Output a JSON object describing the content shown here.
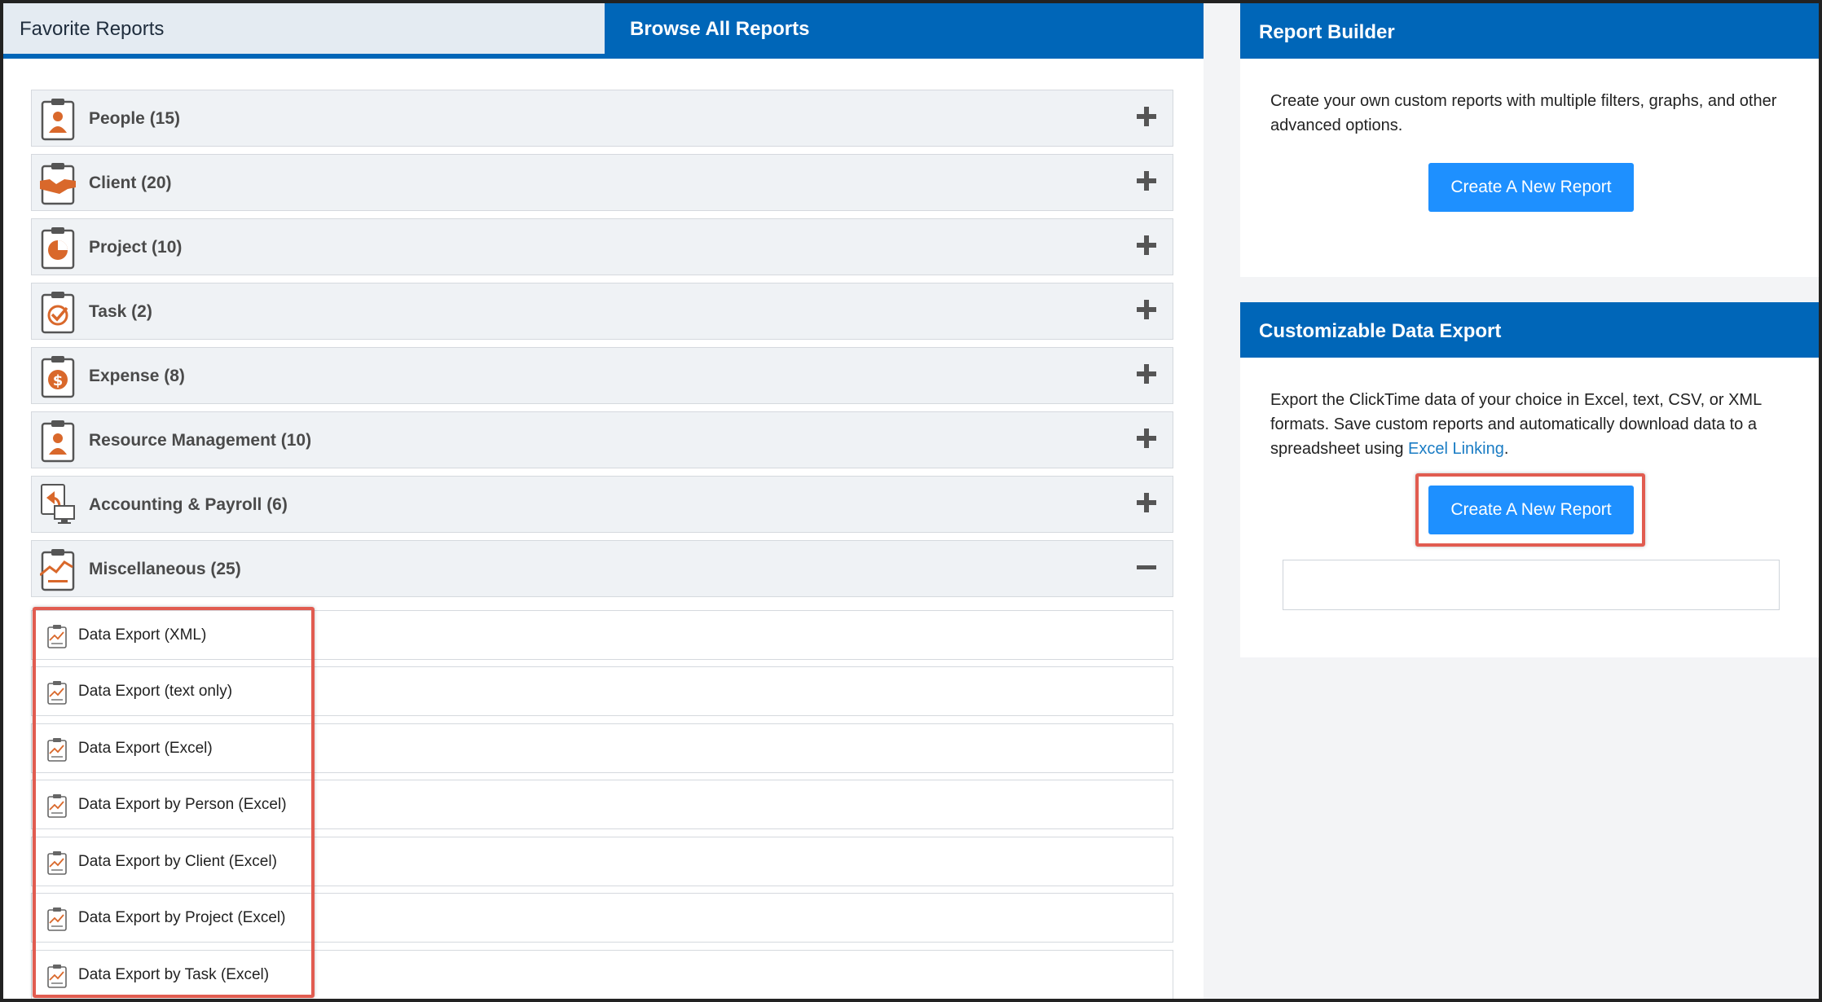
{
  "tabs": {
    "favorites": "Favorite Reports",
    "browse": "Browse All Reports"
  },
  "categories": [
    {
      "label": "People (15)",
      "icon": "person-clipboard-icon",
      "toggle": "plus"
    },
    {
      "label": "Client (20)",
      "icon": "handshake-clipboard-icon",
      "toggle": "plus"
    },
    {
      "label": "Project (10)",
      "icon": "pie-chart-clipboard-icon",
      "toggle": "plus"
    },
    {
      "label": "Task (2)",
      "icon": "checkmark-clipboard-icon",
      "toggle": "plus"
    },
    {
      "label": "Expense (8)",
      "icon": "dollar-clipboard-icon",
      "toggle": "plus"
    },
    {
      "label": "Resource Management (10)",
      "icon": "person-clipboard-icon",
      "toggle": "plus"
    },
    {
      "label": "Accounting & Payroll (6)",
      "icon": "monitor-return-icon",
      "toggle": "plus"
    },
    {
      "label": "Miscellaneous (25)",
      "icon": "line-chart-clipboard-icon",
      "toggle": "minus"
    }
  ],
  "reports": [
    "Data Export (XML)",
    "Data Export (text only)",
    "Data Export (Excel)",
    "Data Export by Person (Excel)",
    "Data Export by Client (Excel)",
    "Data Export by Project (Excel)",
    "Data Export by Task (Excel)"
  ],
  "report_builder": {
    "title": "Report Builder",
    "description": "Create your own custom reports with multiple filters, graphs, and other advanced options.",
    "button": "Create A New Report"
  },
  "data_export": {
    "title": "Customizable Data Export",
    "description_before": "Export the ClickTime data of your choice in Excel, text, CSV, or XML formats. Save custom reports and automatically download data to a spreadsheet using ",
    "link": "Excel Linking",
    "description_after": ".",
    "button": "Create A New Report"
  },
  "colors": {
    "header_blue": "#0066b8",
    "button_blue": "#1e90ff",
    "icon_orange": "#d9682b",
    "highlight_red": "#e15c50"
  }
}
